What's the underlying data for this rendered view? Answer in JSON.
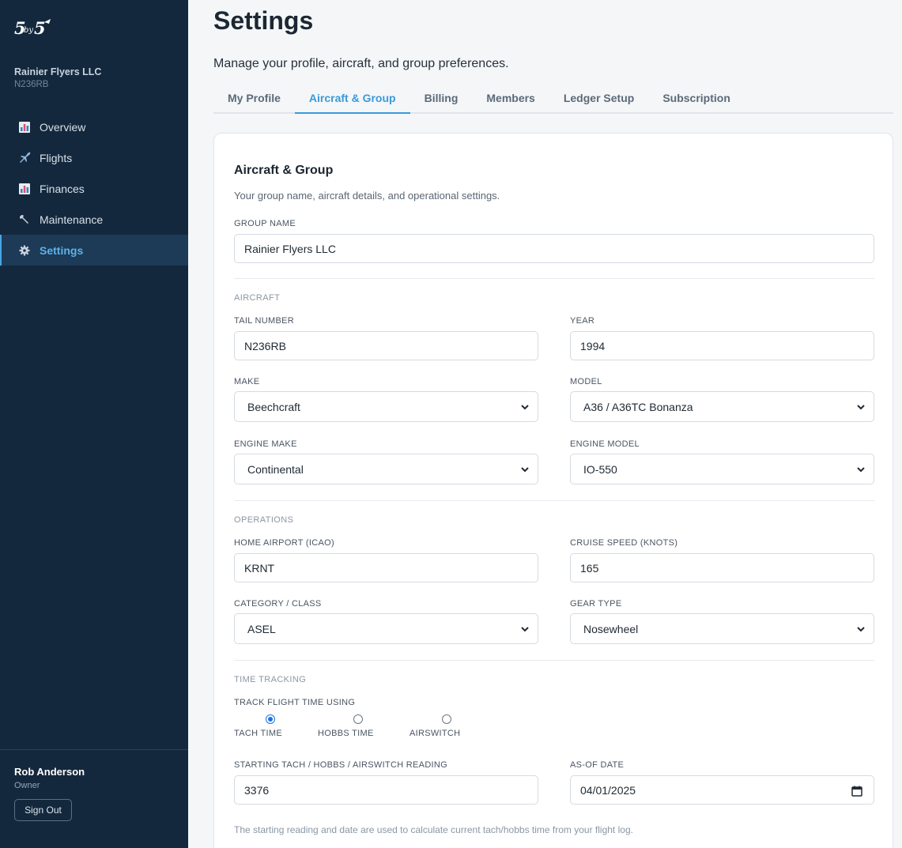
{
  "brand": {
    "logo_text": "5by5"
  },
  "sidebar": {
    "org_name": "Rainier Flyers LLC",
    "org_tail": "N236RB",
    "items": [
      {
        "label": "Overview",
        "icon": "bar-chart-icon"
      },
      {
        "label": "Flights",
        "icon": "airplane-icon"
      },
      {
        "label": "Finances",
        "icon": "bar-chart-icon"
      },
      {
        "label": "Maintenance",
        "icon": "wrench-icon"
      },
      {
        "label": "Settings",
        "icon": "gear-icon",
        "active": true
      }
    ],
    "user_name": "Rob Anderson",
    "user_role": "Owner",
    "signout_label": "Sign Out"
  },
  "header": {
    "title": "Settings",
    "subtitle": "Manage your profile, aircraft, and group preferences."
  },
  "tabs": [
    {
      "label": "My Profile"
    },
    {
      "label": "Aircraft & Group",
      "active": true
    },
    {
      "label": "Billing"
    },
    {
      "label": "Members"
    },
    {
      "label": "Ledger Setup"
    },
    {
      "label": "Subscription"
    }
  ],
  "form": {
    "title": "Aircraft & Group",
    "subtitle": "Your group name, aircraft details, and operational settings.",
    "group_name_label": "GROUP NAME",
    "group_name_value": "Rainier Flyers LLC",
    "aircraft_section": "AIRCRAFT",
    "tail_label": "TAIL NUMBER",
    "tail_value": "N236RB",
    "year_label": "YEAR",
    "year_value": "1994",
    "make_label": "MAKE",
    "make_value": "Beechcraft",
    "model_label": "MODEL",
    "model_value": "A36 / A36TC Bonanza",
    "engine_make_label": "ENGINE MAKE",
    "engine_make_value": "Continental",
    "engine_model_label": "ENGINE MODEL",
    "engine_model_value": "IO-550",
    "operations_section": "OPERATIONS",
    "home_airport_label": "HOME AIRPORT (ICAO)",
    "home_airport_value": "KRNT",
    "cruise_label": "CRUISE SPEED (KNOTS)",
    "cruise_value": "165",
    "category_label": "CATEGORY / CLASS",
    "category_value": "ASEL",
    "gear_label": "GEAR TYPE",
    "gear_value": "Nosewheel",
    "time_section": "TIME TRACKING",
    "track_label": "TRACK FLIGHT TIME USING",
    "track_options": [
      {
        "label": "TACH TIME",
        "checked": true
      },
      {
        "label": "HOBBS TIME",
        "checked": false
      },
      {
        "label": "AIRSWITCH",
        "checked": false
      }
    ],
    "starting_label": "STARTING TACH / HOBBS / AIRSWITCH READING",
    "starting_value": "3376",
    "asof_label": "AS-OF DATE",
    "asof_value": "04/01/2025",
    "footnote": "The starting reading and date are used to calculate current tach/hobbs time from your flight log."
  },
  "colors": {
    "sidebar_bg": "#14283d",
    "accent": "#3a9ad8",
    "radio_checked": "#1a73e8"
  }
}
